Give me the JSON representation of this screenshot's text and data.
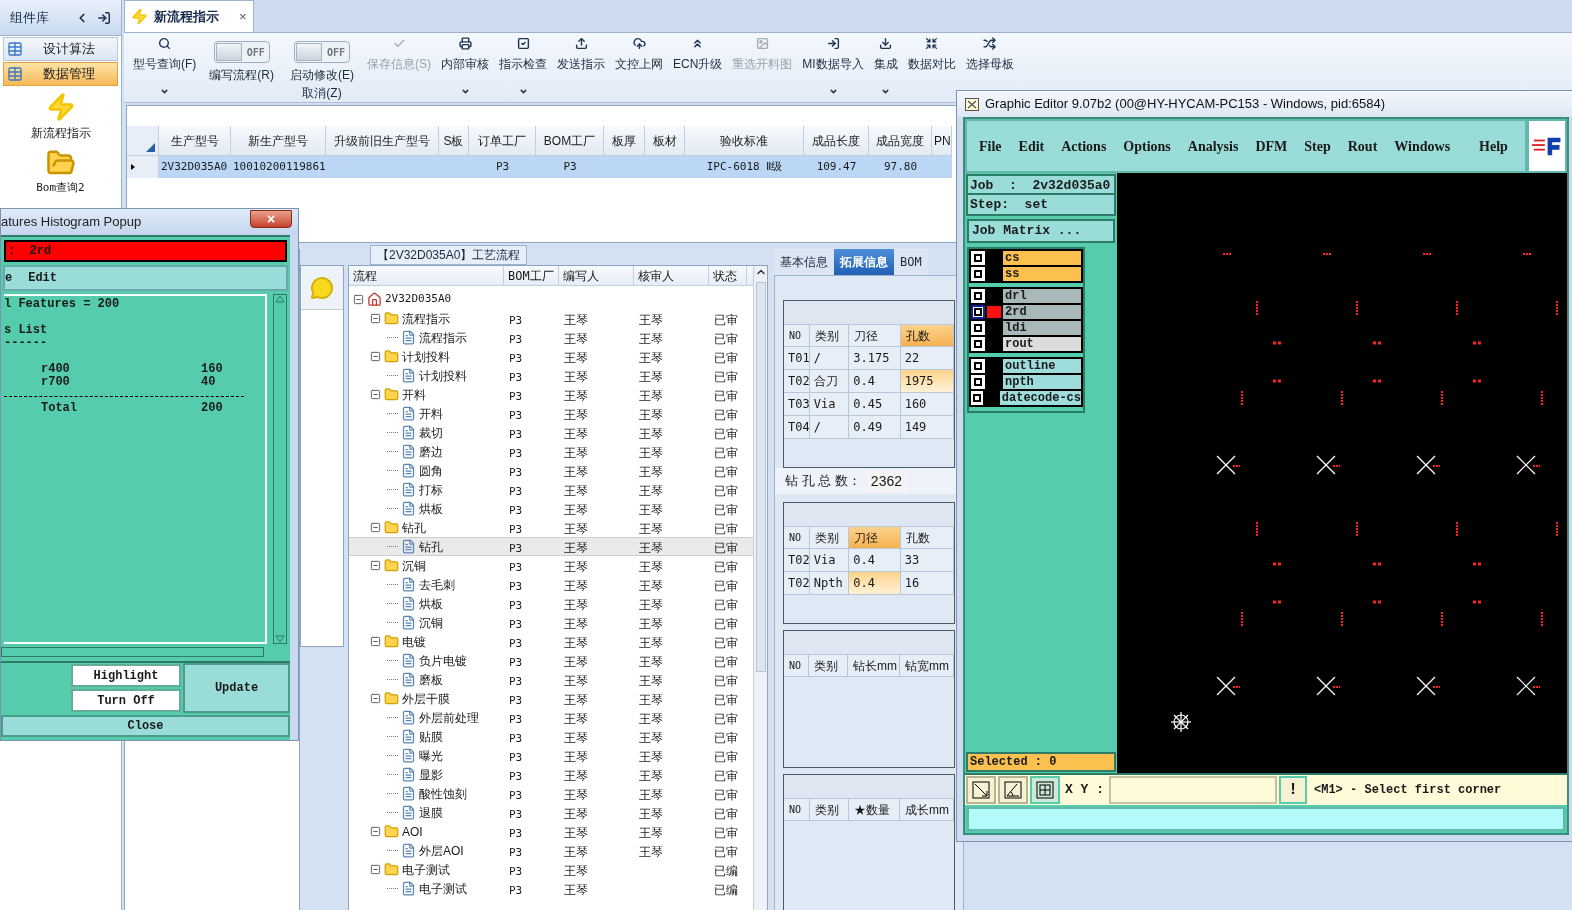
{
  "sidebar": {
    "title": "组件库",
    "items": [
      {
        "label": "设计算法",
        "selected": false
      },
      {
        "label": "数据管理",
        "selected": true
      }
    ],
    "launchers": [
      {
        "kind": "flash",
        "label": "新流程指示"
      },
      {
        "kind": "folder",
        "label": "Bom查询2"
      }
    ]
  },
  "tab": {
    "label": "新流程指示",
    "close": "×"
  },
  "toolbar": [
    {
      "kind": "button",
      "label": "型号查询(F)",
      "disabled": false,
      "dropdown": true
    },
    {
      "kind": "toggle",
      "state_label": "OFF",
      "on": false,
      "label": "编写流程(R)"
    },
    {
      "kind": "toggle",
      "state_label": "OFF",
      "on": false,
      "label": "启动修改(E)",
      "second_line": "取消(Z)"
    },
    {
      "kind": "button",
      "label": "保存信息(S)",
      "disabled": true,
      "dropdown": false
    },
    {
      "kind": "button",
      "label": "内部审核",
      "disabled": false,
      "dropdown": true
    },
    {
      "kind": "button",
      "label": "指示检查",
      "disabled": false,
      "dropdown": true
    },
    {
      "kind": "button",
      "label": "发送指示",
      "disabled": false,
      "dropdown": false
    },
    {
      "kind": "button",
      "label": "文控上网",
      "disabled": false,
      "dropdown": false
    },
    {
      "kind": "button",
      "label": "ECN升级",
      "disabled": false,
      "dropdown": false
    },
    {
      "kind": "button",
      "label": "重选开料图",
      "disabled": true,
      "dropdown": false
    },
    {
      "kind": "button",
      "label": "MI数据导入",
      "disabled": false,
      "dropdown": true
    },
    {
      "kind": "button",
      "label": "集成",
      "disabled": false,
      "dropdown": true
    },
    {
      "kind": "button",
      "label": "数据对比",
      "disabled": false,
      "dropdown": false
    },
    {
      "kind": "button",
      "label": "选择母板",
      "disabled": false,
      "dropdown": false
    }
  ],
  "main_table": {
    "columns": [
      "生产型号",
      "新生产型号",
      "升级前旧生产型号",
      "S板",
      "订单工厂",
      "BOM工厂",
      "板厚",
      "板材",
      "验收标准",
      "成品长度",
      "成品宽度",
      "PN"
    ],
    "rows": [
      {
        "selected": true,
        "cells": [
          "2V32D035A0",
          "10010200119861",
          null,
          null,
          "P3",
          "P3",
          null,
          null,
          "IPC-6018 Ⅱ级",
          "109.47",
          "97.80",
          null
        ]
      }
    ]
  },
  "flow_panel": {
    "title": "【2V32D035A0】工艺流程",
    "columns": [
      "流程",
      "BOM工厂",
      "编写人",
      "核审人",
      "状态"
    ],
    "tree": {
      "kind": "root",
      "label": "2V32D035A0",
      "expanded": true,
      "children": [
        {
          "kind": "folder",
          "label": "流程指示",
          "expanded": true,
          "factory": "P3",
          "writer": "王琴",
          "reviewer": "王琴",
          "status": "已审",
          "selected": false,
          "children": [
            {
              "kind": "file",
              "label": "流程指示",
              "factory": "P3",
              "writer": "王琴",
              "reviewer": "王琴",
              "status": "已审",
              "selected": false
            }
          ]
        },
        {
          "kind": "folder",
          "label": "计划投料",
          "expanded": true,
          "factory": "P3",
          "writer": "王琴",
          "reviewer": "王琴",
          "status": "已审",
          "selected": false,
          "children": [
            {
              "kind": "file",
              "label": "计划投料",
              "factory": "P3",
              "writer": "王琴",
              "reviewer": "王琴",
              "status": "已审",
              "selected": false
            }
          ]
        },
        {
          "kind": "folder",
          "label": "开料",
          "expanded": true,
          "factory": "P3",
          "writer": "王琴",
          "reviewer": "王琴",
          "status": "已审",
          "selected": false,
          "children": [
            {
              "kind": "file",
              "label": "开料",
              "factory": "P3",
              "writer": "王琴",
              "reviewer": "王琴",
              "status": "已审",
              "selected": false
            },
            {
              "kind": "file",
              "label": "裁切",
              "factory": "P3",
              "writer": "王琴",
              "reviewer": "王琴",
              "status": "已审",
              "selected": false
            },
            {
              "kind": "file",
              "label": "磨边",
              "factory": "P3",
              "writer": "王琴",
              "reviewer": "王琴",
              "status": "已审",
              "selected": false
            },
            {
              "kind": "file",
              "label": "圆角",
              "factory": "P3",
              "writer": "王琴",
              "reviewer": "王琴",
              "status": "已审",
              "selected": false
            },
            {
              "kind": "file",
              "label": "打标",
              "factory": "P3",
              "writer": "王琴",
              "reviewer": "王琴",
              "status": "已审",
              "selected": false
            },
            {
              "kind": "file",
              "label": "烘板",
              "factory": "P3",
              "writer": "王琴",
              "reviewer": "王琴",
              "status": "已审",
              "selected": false
            }
          ]
        },
        {
          "kind": "folder",
          "label": "钻孔",
          "expanded": true,
          "factory": "P3",
          "writer": "王琴",
          "reviewer": "王琴",
          "status": "已审",
          "selected": false,
          "children": [
            {
              "kind": "file",
              "label": "钻孔",
              "factory": "P3",
              "writer": "王琴",
              "reviewer": "王琴",
              "status": "已审",
              "selected": true
            }
          ]
        },
        {
          "kind": "folder",
          "label": "沉铜",
          "expanded": true,
          "factory": "P3",
          "writer": "王琴",
          "reviewer": "王琴",
          "status": "已审",
          "selected": false,
          "children": [
            {
              "kind": "file",
              "label": "去毛刺",
              "factory": "P3",
              "writer": "王琴",
              "reviewer": "王琴",
              "status": "已审",
              "selected": false
            },
            {
              "kind": "file",
              "label": "烘板",
              "factory": "P3",
              "writer": "王琴",
              "reviewer": "王琴",
              "status": "已审",
              "selected": false
            },
            {
              "kind": "file",
              "label": "沉铜",
              "factory": "P3",
              "writer": "王琴",
              "reviewer": "王琴",
              "status": "已审",
              "selected": false
            }
          ]
        },
        {
          "kind": "folder",
          "label": "电镀",
          "expanded": true,
          "factory": "P3",
          "writer": "王琴",
          "reviewer": "王琴",
          "status": "已审",
          "selected": false,
          "children": [
            {
              "kind": "file",
              "label": "负片电镀",
              "factory": "P3",
              "writer": "王琴",
              "reviewer": "王琴",
              "status": "已审",
              "selected": false
            },
            {
              "kind": "file",
              "label": "磨板",
              "factory": "P3",
              "writer": "王琴",
              "reviewer": "王琴",
              "status": "已审",
              "selected": false
            }
          ]
        },
        {
          "kind": "folder",
          "label": "外层干膜",
          "expanded": true,
          "factory": "P3",
          "writer": "王琴",
          "reviewer": "王琴",
          "status": "已审",
          "selected": false,
          "children": [
            {
              "kind": "file",
              "label": "外层前处理",
              "factory": "P3",
              "writer": "王琴",
              "reviewer": "王琴",
              "status": "已审",
              "selected": false
            },
            {
              "kind": "file",
              "label": "贴膜",
              "factory": "P3",
              "writer": "王琴",
              "reviewer": "王琴",
              "status": "已审",
              "selected": false
            },
            {
              "kind": "file",
              "label": "曝光",
              "factory": "P3",
              "writer": "王琴",
              "reviewer": "王琴",
              "status": "已审",
              "selected": false
            },
            {
              "kind": "file",
              "label": "显影",
              "factory": "P3",
              "writer": "王琴",
              "reviewer": "王琴",
              "status": "已审",
              "selected": false
            },
            {
              "kind": "file",
              "label": "酸性蚀刻",
              "factory": "P3",
              "writer": "王琴",
              "reviewer": "王琴",
              "status": "已审",
              "selected": false
            },
            {
              "kind": "file",
              "label": "退膜",
              "factory": "P3",
              "writer": "王琴",
              "reviewer": "王琴",
              "status": "已审",
              "selected": false
            }
          ]
        },
        {
          "kind": "folder",
          "label": "AOI",
          "expanded": true,
          "factory": "P3",
          "writer": "王琴",
          "reviewer": "王琴",
          "status": "已审",
          "selected": false,
          "children": [
            {
              "kind": "file",
              "label": "外层AOI",
              "factory": "P3",
              "writer": "王琴",
              "reviewer": "王琴",
              "status": "已审",
              "selected": false
            }
          ]
        },
        {
          "kind": "folder",
          "label": "电子测试",
          "expanded": true,
          "factory": "P3",
          "writer": "王琴",
          "status": "已编",
          "selected": false,
          "children": [
            {
              "kind": "file",
              "label": "电子测试",
              "factory": "P3",
              "writer": "王琴",
              "status": "已编",
              "selected": false
            }
          ]
        }
      ]
    }
  },
  "info_panel": {
    "tabs": [
      {
        "label": "基本信息",
        "selected": false
      },
      {
        "label": "拓展信息",
        "selected": true
      },
      {
        "label": "BOM",
        "selected": false
      }
    ],
    "tables": [
      {
        "columns": [
          {
            "label": "NO",
            "sorted": false
          },
          {
            "label": "类别",
            "sorted": false
          },
          {
            "label": "刀径",
            "sorted": false
          },
          {
            "label": "孔数",
            "sorted": true
          }
        ],
        "rows": [
          {
            "selected": false,
            "cells": [
              "T01",
              "/",
              "3.175",
              "22"
            ]
          },
          {
            "selected": true,
            "cells": [
              "T02",
              "合刀",
              "0.4",
              "1975"
            ]
          },
          {
            "selected": false,
            "cells": [
              "T03",
              "Via",
              "0.45",
              "160"
            ]
          },
          {
            "selected": false,
            "cells": [
              "T04",
              "/",
              "0.49",
              "149"
            ]
          }
        ],
        "total_label": "钻 孔 总 数：",
        "total_value": "2362"
      },
      {
        "columns": [
          {
            "label": "NO",
            "sorted": false
          },
          {
            "label": "类别",
            "sorted": false
          },
          {
            "label": "刀径",
            "sorted": true
          },
          {
            "label": "孔数",
            "sorted": false
          }
        ],
        "rows": [
          {
            "selected": false,
            "cells": [
              "T02",
              "Via",
              "0.4",
              "33"
            ]
          },
          {
            "selected": true,
            "cells": [
              "T02",
              "Npth",
              "0.4",
              "16"
            ]
          }
        ]
      },
      {
        "columns": [
          {
            "label": "NO",
            "sorted": false
          },
          {
            "label": "类别",
            "sorted": false
          },
          {
            "label": "钻长mm",
            "sorted": false
          },
          {
            "label": "钻宽mm",
            "sorted": false
          }
        ]
      },
      {
        "columns": [
          {
            "label": "NO",
            "sorted": false
          },
          {
            "label": "类别",
            "sorted": false
          },
          {
            "label": "★数量",
            "sorted": false
          },
          {
            "label": "成长mm",
            "sorted": false
          }
        ]
      }
    ]
  },
  "histogram_popup": {
    "title": "atures Histogram Popup",
    "close": "×",
    "layer_bar": ":  2rd",
    "menu": [
      "e",
      "Edit"
    ],
    "lines": [
      {
        "kind": "text",
        "text": "l Features = 200"
      },
      {
        "kind": "blank"
      },
      {
        "kind": "text",
        "text": "s List"
      },
      {
        "kind": "text",
        "text": "------"
      },
      {
        "kind": "blank"
      },
      {
        "kind": "row",
        "name": "r400",
        "count": "160"
      },
      {
        "kind": "row",
        "name": "r700",
        "count": "40"
      },
      {
        "kind": "rule"
      },
      {
        "kind": "row",
        "name": "Total",
        "count": "200"
      }
    ],
    "buttons": {
      "highlight": "Highlight",
      "turn_off": "Turn Off",
      "update": "Update",
      "close": "Close"
    }
  },
  "graphic_editor": {
    "title": "Graphic Editor 9.07b2 (00@HY-HYCAM-PC153 - Windows, pid:6584)",
    "menu": [
      "File",
      "Edit",
      "Actions",
      "Options",
      "Analysis",
      "DFM",
      "Step",
      "Rout",
      "Windows",
      "Help"
    ],
    "job": "Job  :  2v32d035a0",
    "step": "Step:  set",
    "job_matrix": "Job Matrix ...",
    "layer_groups": [
      {
        "layers": [
          {
            "name": "cs",
            "color": "#fcc04f",
            "work": false
          },
          {
            "name": "ss",
            "color": "#fcc04f",
            "work": false
          }
        ]
      },
      {
        "layers": [
          {
            "name": "drl",
            "color": "#a8b8b8",
            "work": false
          },
          {
            "name": "2rd",
            "color": "#a8b8b8",
            "work": true
          },
          {
            "name": "ldi",
            "color": "#a8b8b8",
            "work": false
          },
          {
            "name": "rout",
            "color": "#dcdcdc",
            "work": false
          }
        ]
      },
      {
        "layers": [
          {
            "name": "outline",
            "color": "#9fdcdc",
            "work": false
          },
          {
            "name": "npth",
            "color": "#9fdcdc",
            "work": false
          },
          {
            "name": "datecode-cs",
            "color": "#9fdcdc",
            "work": false
          }
        ]
      }
    ],
    "selected": "Selected : 0",
    "xy_label": "X Y :",
    "exclaim": "!",
    "prompt": "<M1> - Select first corner"
  }
}
